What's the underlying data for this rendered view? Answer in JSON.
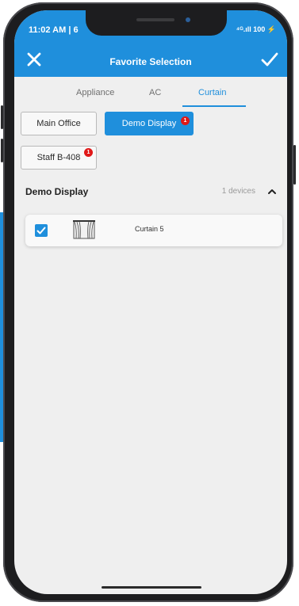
{
  "status_bar": {
    "time": "11:02 AM | 6",
    "right": "⁴ᴳ.ıll 100 ⚡"
  },
  "header": {
    "title": "Favorite Selection",
    "close_icon": "close-icon",
    "confirm_icon": "check-icon"
  },
  "tabs": [
    {
      "label": "Appliance",
      "active": false
    },
    {
      "label": "AC",
      "active": false
    },
    {
      "label": "Curtain",
      "active": true
    }
  ],
  "rooms": [
    {
      "label": "Main Office",
      "selected": false,
      "badge": ""
    },
    {
      "label": "Demo Display",
      "selected": true,
      "badge": "1"
    },
    {
      "label": "Staff B-408",
      "selected": false,
      "badge": "1"
    }
  ],
  "group": {
    "title": "Demo Display",
    "count": "1 devices",
    "expanded": true
  },
  "devices": [
    {
      "name": "Curtain 5",
      "checked": true,
      "icon": "curtain-icon"
    }
  ],
  "colors": {
    "accent": "#1f8fdc",
    "badge": "#e01818"
  }
}
